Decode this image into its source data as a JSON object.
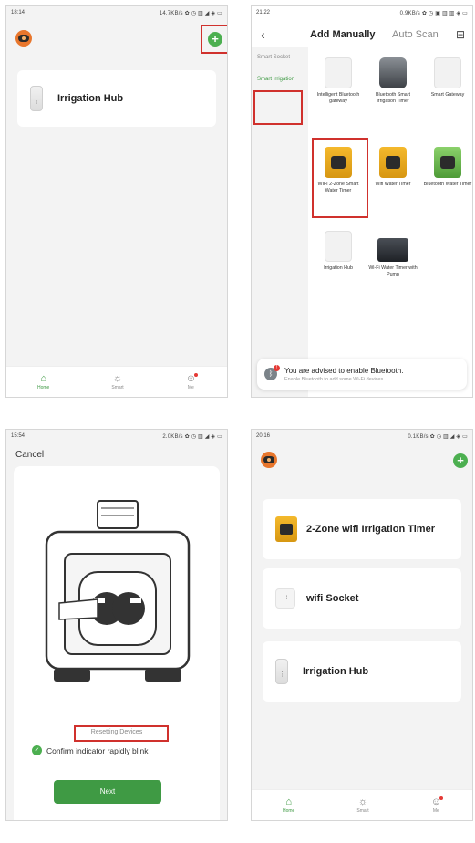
{
  "p1": {
    "status_time": "18:14",
    "status_right": "14.7KB/s ✿ ◷ ▥ ◢ ◈ ▭",
    "device_card_label": "Irrigation Hub",
    "tabs": [
      {
        "label": "Home",
        "icon": "home-icon"
      },
      {
        "label": "Smart",
        "icon": "sun-icon"
      },
      {
        "label": "Me",
        "icon": "user-icon"
      }
    ]
  },
  "p2": {
    "status_time": "21:22",
    "status_right": "0.9KB/s ✿ ◷ ▣ ▥ ▥ ◈ ▭",
    "back_glyph": "‹",
    "tab_active": "Add Manually",
    "tab_other": "Auto Scan",
    "scan_glyph": "⊟",
    "categories": [
      "Smart Socket",
      "Smart Irrigation"
    ],
    "devices": [
      {
        "label": "Intelligent Bluetooth gateway",
        "thumb": "white"
      },
      {
        "label": "Bluetooth Smart Irrigation Timer",
        "thumb": "gray"
      },
      {
        "label": "Smart Gateway",
        "thumb": "white"
      },
      {
        "label": "WIFI 2-Zone Smart Water Timer",
        "thumb": "yellow"
      },
      {
        "label": "Wifi Water Timer",
        "thumb": "yellow"
      },
      {
        "label": "Bluetooth Water Timer",
        "thumb": "green"
      },
      {
        "label": "Irrigation Hub",
        "thumb": "white"
      },
      {
        "label": "Wi-Fi Water Timer with Pump",
        "thumb": "dark"
      }
    ],
    "toast_title": "You are advised to enable Bluetooth.",
    "toast_sub": "Enable Bluetooth to add some Wi-Fi devices ..."
  },
  "p3": {
    "status_time": "15:54",
    "status_right": "2.0KB/s ✿ ◷ ▥ ◢ ◈ ▭",
    "cancel_label": "Cancel",
    "reset_text": "Resetting Devices",
    "confirm_text": "Confirm indicator rapidly blink",
    "next_label": "Next"
  },
  "p4": {
    "status_time": "20:16",
    "status_right": "0.1KB/s ✿ ◷ ▥ ◢ ◈ ▭",
    "cards": [
      "2-Zone wifi Irrigation Timer",
      "wifi Socket",
      "Irrigation Hub"
    ],
    "socket_glyph": "⁞ ⁞",
    "tabs": [
      {
        "label": "Home",
        "icon": "home-icon"
      },
      {
        "label": "Smart",
        "icon": "sun-icon"
      },
      {
        "label": "Me",
        "icon": "user-icon"
      }
    ]
  },
  "colors": {
    "accent": "#4caf50",
    "highlight": "#d0312d",
    "avatar": "#e8762c"
  }
}
